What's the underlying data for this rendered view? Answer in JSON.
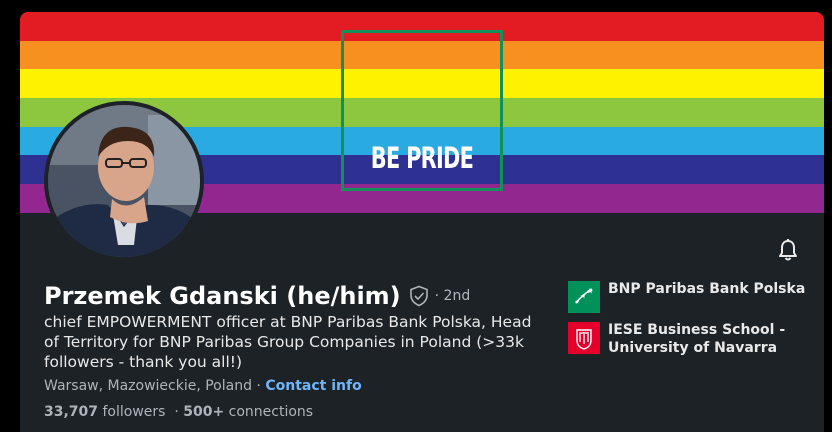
{
  "banner": {
    "text": "BE PRIDE",
    "stripe_colors": [
      "#e31b23",
      "#f7901e",
      "#fff200",
      "#8dc63f",
      "#29aae1",
      "#2e3192",
      "#92278f"
    ],
    "frame_color": "#138f5a"
  },
  "profile": {
    "name": "Przemek Gdanski (he/him)",
    "degree": "· 2nd",
    "headline": "chief EMPOWERMENT officer at BNP Paribas Bank Polska, Head of Territory for BNP Paribas Group Companies in Poland (>33k followers - thank you all!)",
    "location": "Warsaw, Mazowieckie, Poland",
    "separator": " · ",
    "contact_info": "Contact info",
    "followers_count": "33,707",
    "followers_label": " followers",
    "connections_sep": "  · ",
    "connections_count": "500+",
    "connections_label": " connections"
  },
  "organizations": [
    {
      "name": "BNP Paribas Bank Polska",
      "logo_color": "#00915a",
      "icon": "bnp-stars-icon"
    },
    {
      "name": "IESE Business School - University of Navarra",
      "logo_color": "#e4002b",
      "icon": "iese-crest-icon"
    }
  ],
  "icons": {
    "notification": "bell-icon",
    "verification": "shield-check-icon"
  },
  "colors": {
    "card_bg": "#1d2226",
    "link": "#70b5f9",
    "muted": "#aeb4ba"
  }
}
